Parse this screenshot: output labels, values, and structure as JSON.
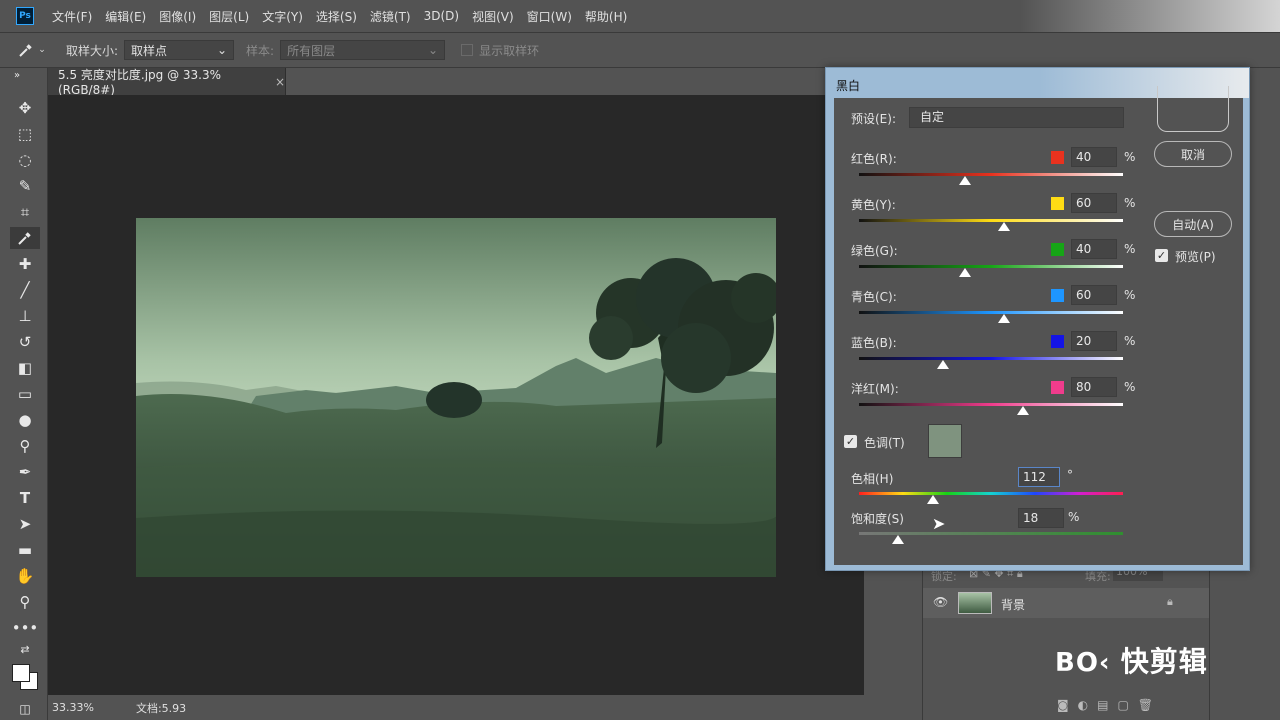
{
  "app": {
    "logo": "Ps"
  },
  "menu": [
    "文件(F)",
    "编辑(E)",
    "图像(I)",
    "图层(L)",
    "文字(Y)",
    "选择(S)",
    "滤镜(T)",
    "3D(D)",
    "视图(V)",
    "窗口(W)",
    "帮助(H)"
  ],
  "options": {
    "tool_icon": "eyedropper-icon",
    "sample_size_label": "取样大小:",
    "sample_size_value": "取样点",
    "sample_label": "样本:",
    "sample_value": "所有图层",
    "show_ring_label": "显示取样环"
  },
  "document": {
    "tab_title": "5.5 亮度对比度.jpg @ 33.3%(RGB/8#)",
    "tab_close": "×",
    "zoom": "33.33%",
    "doc_info": "文档:5.93"
  },
  "dialog": {
    "title": "黑白",
    "preset_label": "预设(E):",
    "preset_value": "自定",
    "sliders": [
      {
        "label": "红色(R):",
        "value": "40",
        "color": "#e8321e",
        "level": 0.4
      },
      {
        "label": "黄色(Y):",
        "value": "60",
        "color": "#ffdc14",
        "level": 0.55
      },
      {
        "label": "绿色(G):",
        "value": "40",
        "color": "#16a516",
        "level": 0.4
      },
      {
        "label": "青色(C):",
        "value": "60",
        "color": "#1e96ff",
        "level": 0.55
      },
      {
        "label": "蓝色(B):",
        "value": "20",
        "color": "#1414e6",
        "level": 0.32
      },
      {
        "label": "洋红(M):",
        "value": "80",
        "color": "#f03c8c",
        "level": 0.62
      }
    ],
    "percent": "%",
    "tint_label": "色调(T)",
    "tint_color": "#7f937f",
    "hue_label": "色相(H)",
    "hue_value": "112",
    "hue_unit": "°",
    "saturation_label": "饱和度(S)",
    "saturation_value": "18",
    "saturation_unit": "%",
    "cancel_label": "取消",
    "auto_label": "自动(A)",
    "preview_label": "预览(P)"
  },
  "layers": {
    "lock_label": "锁定:",
    "fill_label": "填充:",
    "fill_value": "100%",
    "layer_name": "背景"
  },
  "watermark": "快剪辑"
}
